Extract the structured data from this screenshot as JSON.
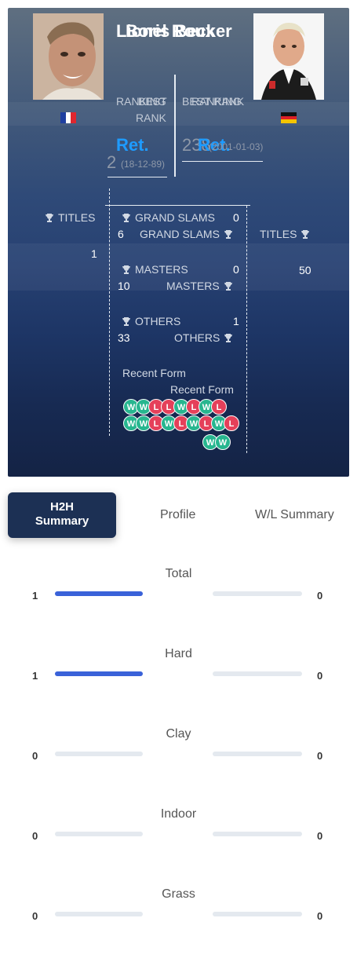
{
  "header": {
    "player_left": {
      "name": "Lionel Roux",
      "country": "France"
    },
    "player_right": {
      "name": "Boris Becker",
      "country": "Germany"
    },
    "left_stats": {
      "ranking_label": "RANKING",
      "ranking_value": "Ret.",
      "best_rank_label": "BEST RANK",
      "best_rank_value": "2",
      "best_rank_date": "(18-12-89)"
    },
    "right_stats": {
      "ranking_label": "RANKING",
      "ranking_value": "Ret.",
      "best_rank_label": "BEST RANK",
      "best_rank_value": "238",
      "best_rank_date": "(2001-01-03)"
    },
    "titles": {
      "titles_label": "TITLES",
      "grand_slams_label": "GRAND SLAMS",
      "masters_label": "MASTERS",
      "others_label": "OTHERS",
      "left": {
        "titles": "1",
        "grand_slams": "0",
        "masters": "0",
        "others": "1"
      },
      "right": {
        "titles": "50",
        "grand_slams": "6",
        "masters": "10",
        "others": "33"
      }
    },
    "recent_form_label": "Recent Form",
    "left_form": [
      "W",
      "W",
      "L",
      "L",
      "W",
      "L",
      "W",
      "L"
    ],
    "right_form": [
      "W",
      "W",
      "L",
      "W",
      "L",
      "W",
      "L",
      "W",
      "L",
      "W",
      "W"
    ]
  },
  "tabs": {
    "h2h_line1": "H2H",
    "h2h_line2": "Summary",
    "profile": "Profile",
    "wl_summary": "W/L Summary"
  },
  "surfaces": [
    {
      "name": "Total",
      "left": "1",
      "right": "0",
      "left_share": 1,
      "right_share": 0
    },
    {
      "name": "Hard",
      "left": "1",
      "right": "0",
      "left_share": 1,
      "right_share": 0
    },
    {
      "name": "Clay",
      "left": "0",
      "right": "0",
      "left_share": 0,
      "right_share": 0
    },
    {
      "name": "Indoor",
      "left": "0",
      "right": "0",
      "left_share": 0,
      "right_share": 0
    },
    {
      "name": "Grass",
      "left": "0",
      "right": "0",
      "left_share": 0,
      "right_share": 0
    }
  ],
  "colors": {
    "accent_blue": "#1e9bff",
    "bar_fill": "#3a62d9",
    "win": "#27b68f",
    "loss": "#e5405a",
    "tab_active": "#1c3054"
  },
  "icons": {
    "trophy": "trophy-icon"
  }
}
